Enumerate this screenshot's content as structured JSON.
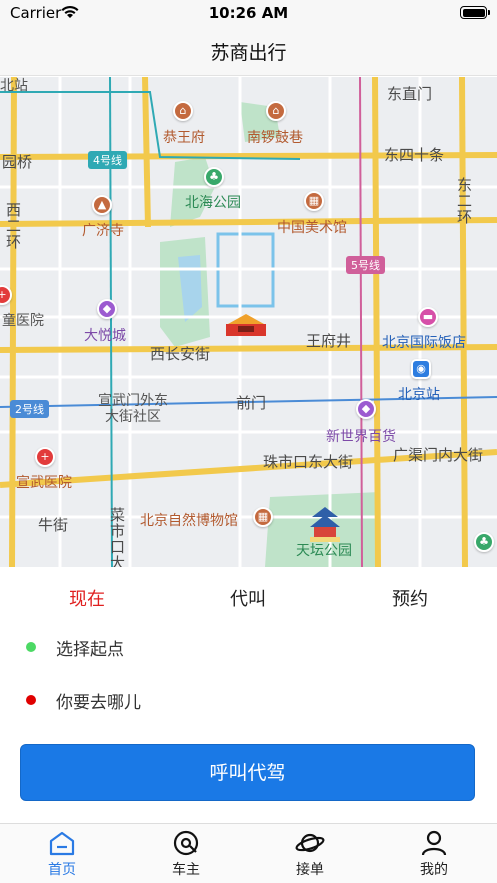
{
  "status_bar": {
    "carrier": "Carrier",
    "time": "10:26 AM"
  },
  "nav": {
    "title": "苏商出行"
  },
  "map": {
    "labels": {
      "gongwangfu": "恭王府",
      "nanluoguxiang": "南锣鼓巷",
      "dongzhimen": "东直门",
      "line4": "4号线",
      "dongsishitiao": "东四十条",
      "beihai_park": "北海公园",
      "guangji_temple": "广济寺",
      "art_museum": "中国美术馆",
      "line5": "5号线",
      "xierhuan": "西二环",
      "dongerhuan": "东二环",
      "yuanqiao": "园桥",
      "tonghospital": "童医院",
      "joycity": "大悦城",
      "beijing_hotel": "北京国际饭店",
      "xichanganjie": "西长安街",
      "wangfujing": "王府井",
      "line2": "2号线",
      "xuanwumen_community": "宣武门外东\n大街社区",
      "qianmen": "前门",
      "beijing_station": "北京站",
      "new_world": "新世界百货",
      "xuanwu_hospital": "宣武医院",
      "zhushikou": "珠市口东大街",
      "guangqumen": "广渠门内大街",
      "niujie": "牛街",
      "natural_history": "北京自然博物馆",
      "temple_of_heaven": "天坛公园",
      "caishikou": "菜市口大",
      "ganshan": "北站"
    }
  },
  "tabs": [
    {
      "label": "现在",
      "active": true
    },
    {
      "label": "代叫",
      "active": false
    },
    {
      "label": "预约",
      "active": false
    }
  ],
  "origin": {
    "label": "选择起点"
  },
  "destination": {
    "label": "你要去哪儿"
  },
  "call_button": {
    "label": "呼叫代驾"
  },
  "tabbar": [
    {
      "label": "首页",
      "icon": "home-icon",
      "active": true
    },
    {
      "label": "车主",
      "icon": "steering-wheel-icon",
      "active": false
    },
    {
      "label": "接单",
      "icon": "planet-icon",
      "active": false
    },
    {
      "label": "我的",
      "icon": "profile-icon",
      "active": false
    }
  ],
  "colors": {
    "accent": "#1a79e6",
    "active_tab": "#e02020",
    "tabbar_active": "#2a7ae4",
    "origin_dot": "#4cd964",
    "dest_dot": "#e00000"
  }
}
